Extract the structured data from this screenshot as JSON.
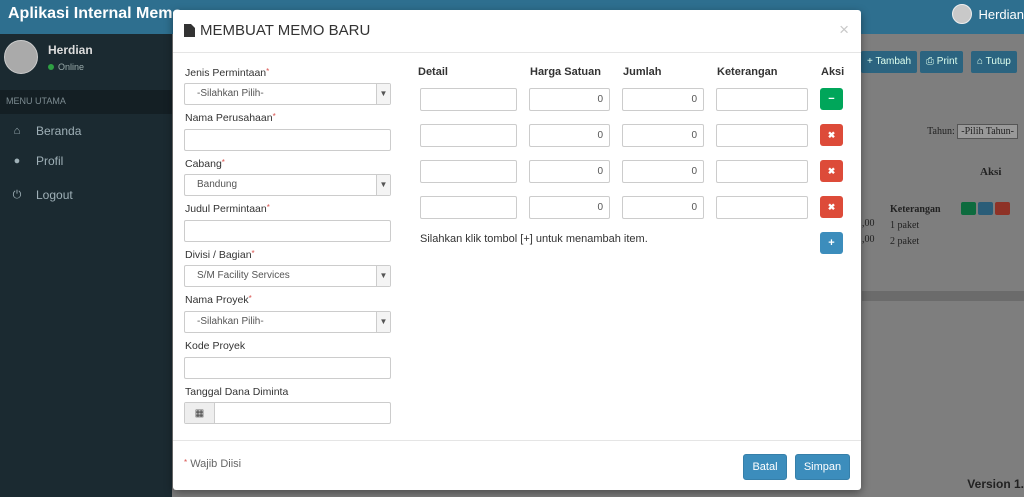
{
  "app": {
    "brand": "Aplikasi Internal Memo",
    "top_user": "Herdian",
    "version_label": "Version 1.",
    "colors": {
      "header": "#2e6f8f",
      "sidebar": "#1b2a31",
      "primary": "#3c8dbc",
      "success": "#00a65a",
      "danger": "#dd4b39"
    }
  },
  "sidebar": {
    "user_name": "Herdian",
    "user_status": "Online",
    "header": "MENU UTAMA",
    "items": [
      {
        "label": "Beranda",
        "icon": "home-icon"
      },
      {
        "label": "Profil",
        "icon": "user-icon"
      },
      {
        "label": "Logout",
        "icon": "power-icon"
      }
    ]
  },
  "background": {
    "buttons": [
      {
        "label": "Tambah",
        "icon": "plus-icon"
      },
      {
        "label": "Print",
        "icon": "print-icon"
      },
      {
        "label": "Tutup",
        "icon": "home-icon"
      }
    ],
    "filter_label": "Tahun:",
    "filter_value": "-Pilih Tahun-",
    "table_aksi": "Aksi",
    "table_keterangan": "Keterangan",
    "rows": [
      {
        "value": ",00",
        "keterangan": "1 paket"
      },
      {
        "value": ",00",
        "keterangan": "2 paket"
      }
    ]
  },
  "modal": {
    "title": "MEMBUAT MEMO BARU",
    "close_label": "×",
    "form": {
      "jenis_label": "Jenis Permintaan",
      "jenis_value": "-Silahkan Pilih-",
      "perusahaan_label": "Nama Perusahaan",
      "perusahaan_value": "",
      "cabang_label": "Cabang",
      "cabang_value": "Bandung",
      "judul_label": "Judul Permintaan",
      "judul_value": "",
      "divisi_label": "Divisi / Bagian",
      "divisi_value": "S/M Facility Services",
      "proyek_label": "Nama Proyek",
      "proyek_value": "-Silahkan Pilih-",
      "kode_label": "Kode Proyek",
      "kode_value": "",
      "tanggal_label": "Tanggal Dana Diminta",
      "tanggal_value": ""
    },
    "items_table": {
      "headers": [
        "Detail",
        "Harga Satuan",
        "Jumlah",
        "Keterangan",
        "Aksi"
      ],
      "rows": [
        {
          "detail": "",
          "harga": "0",
          "jumlah": "0",
          "keterangan": "",
          "action": "remove-first"
        },
        {
          "detail": "",
          "harga": "0",
          "jumlah": "0",
          "keterangan": "",
          "action": "delete"
        },
        {
          "detail": "",
          "harga": "0",
          "jumlah": "0",
          "keterangan": "",
          "action": "delete"
        },
        {
          "detail": "",
          "harga": "0",
          "jumlah": "0",
          "keterangan": "",
          "action": "delete"
        }
      ],
      "minus_label": "−",
      "delete_label": "✖",
      "add_label": "+",
      "hint": "Silahkan klik tombol [+] untuk menambah item."
    },
    "footer": {
      "required_note": "Wajib Diisi",
      "cancel_label": "Batal",
      "save_label": "Simpan"
    }
  }
}
